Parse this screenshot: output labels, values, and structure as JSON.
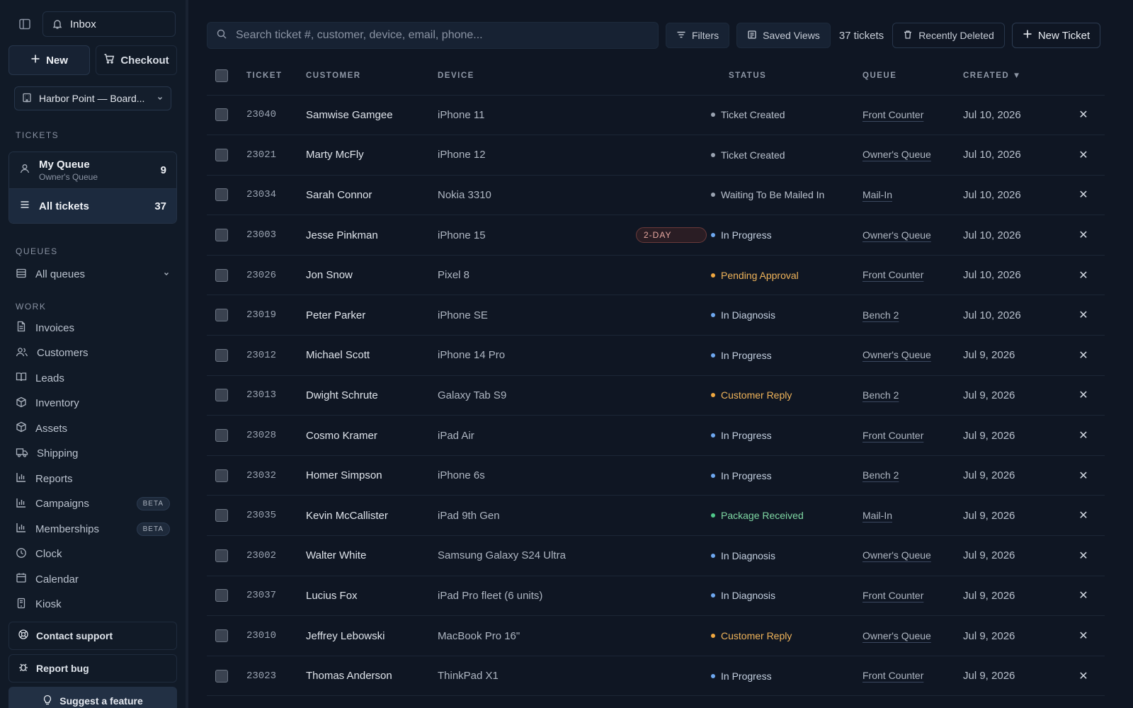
{
  "sidebar": {
    "inbox_label": "Inbox",
    "new_label": "New",
    "checkout_label": "Checkout",
    "location": "Harbor Point — Board...",
    "tickets_section": "TICKETS",
    "my_queue": {
      "title": "My Queue",
      "subtitle": "Owner's Queue",
      "count": "9"
    },
    "all_tickets": {
      "title": "All tickets",
      "count": "37"
    },
    "queues_section": "QUEUES",
    "all_queues": "All queues",
    "work_section": "WORK",
    "work_items": [
      {
        "label": "Invoices",
        "icon": "file-icon"
      },
      {
        "label": "Customers",
        "icon": "users-icon"
      },
      {
        "label": "Leads",
        "icon": "book-icon"
      },
      {
        "label": "Inventory",
        "icon": "box-icon"
      },
      {
        "label": "Assets",
        "icon": "box-icon"
      },
      {
        "label": "Shipping",
        "icon": "truck-icon"
      },
      {
        "label": "Reports",
        "icon": "bar-chart-icon"
      },
      {
        "label": "Campaigns",
        "icon": "bar-chart-icon",
        "badge": "BETA"
      },
      {
        "label": "Memberships",
        "icon": "bar-chart-icon",
        "badge": "BETA"
      },
      {
        "label": "Clock",
        "icon": "clock-icon"
      },
      {
        "label": "Calendar",
        "icon": "calendar-icon"
      },
      {
        "label": "Kiosk",
        "icon": "tablet-icon"
      }
    ],
    "contact_support": "Contact support",
    "report_bug": "Report bug",
    "suggest_feature": "Suggest a feature"
  },
  "toolbar": {
    "search_placeholder": "Search ticket #, customer, device, email, phone...",
    "filters": "Filters",
    "saved_views": "Saved Views",
    "ticket_count": "37 tickets",
    "recently_deleted": "Recently Deleted",
    "new_ticket": "New Ticket"
  },
  "table": {
    "columns": {
      "ticket": "TICKET",
      "customer": "CUSTOMER",
      "device": "DEVICE",
      "status": "STATUS",
      "queue": "QUEUE",
      "created": "CREATED ▼"
    },
    "rows": [
      {
        "ticket": "23040",
        "customer": "Samwise Gamgee",
        "device": "iPhone 11",
        "tag": "",
        "status": "Ticket Created",
        "status_color": "#9aa3b1",
        "queue": "Front Counter",
        "created": "Jul 10, 2026"
      },
      {
        "ticket": "23021",
        "customer": "Marty McFly",
        "device": "iPhone 12",
        "tag": "",
        "status": "Ticket Created",
        "status_color": "#9aa3b1",
        "queue": "Owner's Queue",
        "created": "Jul 10, 2026"
      },
      {
        "ticket": "23034",
        "customer": "Sarah Connor",
        "device": "Nokia 3310",
        "tag": "",
        "status": "Waiting To Be Mailed In",
        "status_color": "#9aa3b1",
        "queue": "Mail-In",
        "created": "Jul 10, 2026"
      },
      {
        "ticket": "23003",
        "customer": "Jesse Pinkman",
        "device": "iPhone 15",
        "tag": "2-DAY",
        "status": "In Progress",
        "status_color": "#6ea8f0",
        "queue": "Owner's Queue",
        "created": "Jul 10, 2026"
      },
      {
        "ticket": "23026",
        "customer": "Jon Snow",
        "device": "Pixel 8",
        "tag": "",
        "status": "Pending Approval",
        "status_color": "#f0a840",
        "queue": "Front Counter",
        "created": "Jul 10, 2026"
      },
      {
        "ticket": "23019",
        "customer": "Peter Parker",
        "device": "iPhone SE",
        "tag": "",
        "status": "In Diagnosis",
        "status_color": "#6ea8f0",
        "queue": "Bench 2",
        "created": "Jul 10, 2026"
      },
      {
        "ticket": "23012",
        "customer": "Michael Scott",
        "device": "iPhone 14 Pro",
        "tag": "",
        "status": "In Progress",
        "status_color": "#6ea8f0",
        "queue": "Owner's Queue",
        "created": "Jul 9, 2026"
      },
      {
        "ticket": "23013",
        "customer": "Dwight Schrute",
        "device": "Galaxy Tab S9",
        "tag": "",
        "status": "Customer Reply",
        "status_color": "#f0a840",
        "queue": "Bench 2",
        "created": "Jul 9, 2026"
      },
      {
        "ticket": "23028",
        "customer": "Cosmo Kramer",
        "device": "iPad Air",
        "tag": "",
        "status": "In Progress",
        "status_color": "#6ea8f0",
        "queue": "Front Counter",
        "created": "Jul 9, 2026"
      },
      {
        "ticket": "23032",
        "customer": "Homer Simpson",
        "device": "iPhone 6s",
        "tag": "",
        "status": "In Progress",
        "status_color": "#6ea8f0",
        "queue": "Bench 2",
        "created": "Jul 9, 2026"
      },
      {
        "ticket": "23035",
        "customer": "Kevin McCallister",
        "device": "iPad 9th Gen",
        "tag": "",
        "status": "Package Received",
        "status_color": "#4fc98a",
        "queue": "Mail-In",
        "created": "Jul 9, 2026"
      },
      {
        "ticket": "23002",
        "customer": "Walter White",
        "device": "Samsung Galaxy S24 Ultra",
        "tag": "",
        "status": "In Diagnosis",
        "status_color": "#6ea8f0",
        "queue": "Owner's Queue",
        "created": "Jul 9, 2026"
      },
      {
        "ticket": "23037",
        "customer": "Lucius Fox",
        "device": "iPad Pro fleet (6 units)",
        "tag": "",
        "status": "In Diagnosis",
        "status_color": "#6ea8f0",
        "queue": "Front Counter",
        "created": "Jul 9, 2026"
      },
      {
        "ticket": "23010",
        "customer": "Jeffrey Lebowski",
        "device": "MacBook Pro 16\"",
        "tag": "",
        "status": "Customer Reply",
        "status_color": "#f0a840",
        "queue": "Owner's Queue",
        "created": "Jul 9, 2026"
      },
      {
        "ticket": "23023",
        "customer": "Thomas Anderson",
        "device": "ThinkPad X1",
        "tag": "",
        "status": "In Progress",
        "status_color": "#6ea8f0",
        "queue": "Front Counter",
        "created": "Jul 9, 2026"
      }
    ]
  }
}
